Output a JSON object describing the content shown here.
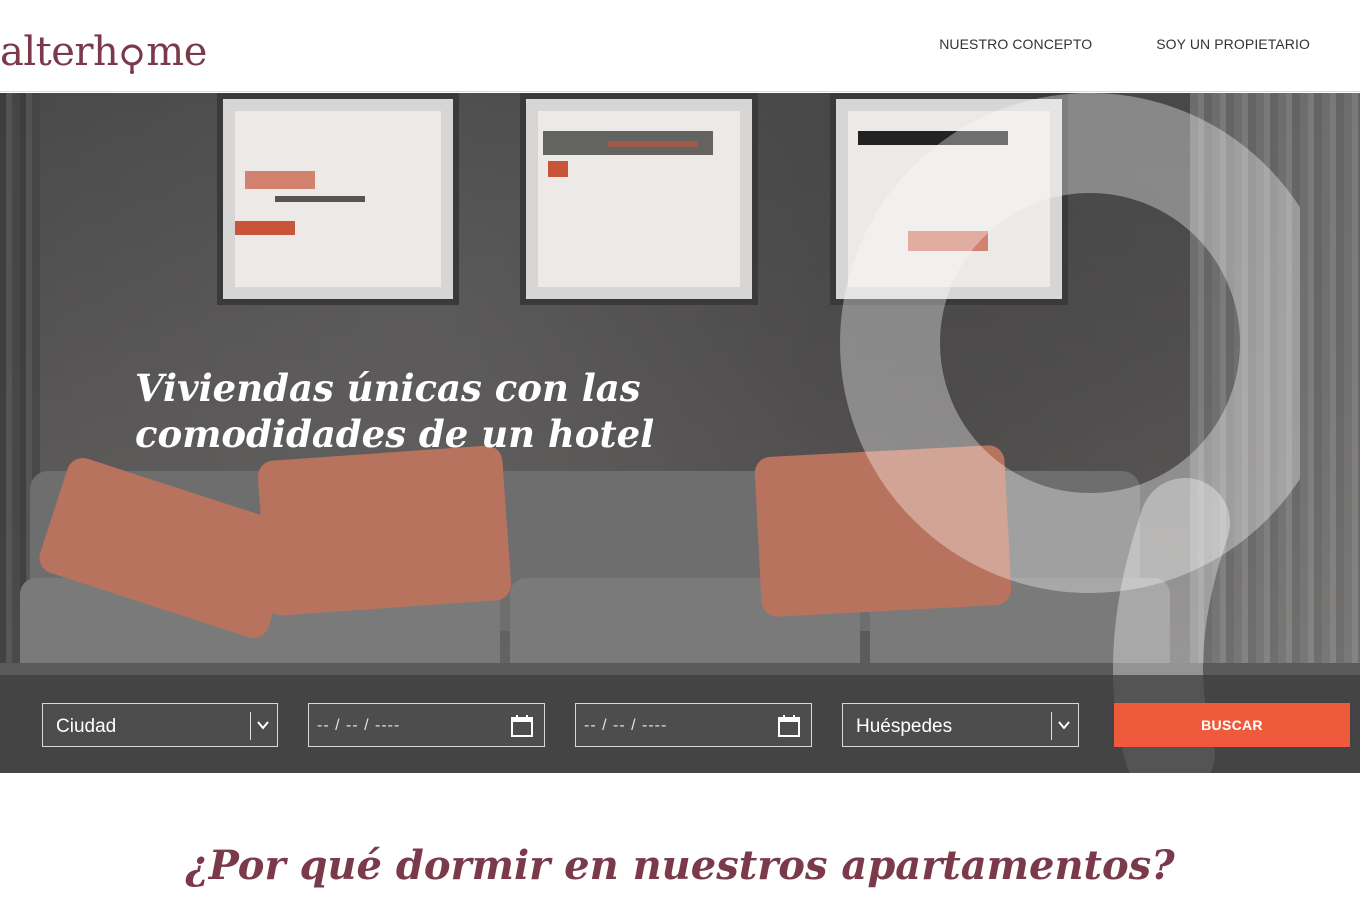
{
  "brand": {
    "logo_pre": "alterh",
    "logo_post": "me",
    "color": "#7a3a4c"
  },
  "nav": {
    "items": [
      {
        "label": "NUESTRO CONCEPTO"
      },
      {
        "label": "SOY UN PROPIETARIO"
      }
    ]
  },
  "hero": {
    "title_line1": "Viviendas únicas con las",
    "title_line2": "comodidades de un hotel"
  },
  "search": {
    "city_placeholder": "Ciudad",
    "checkin_placeholder": "-- / -- / ----",
    "checkout_placeholder": "-- / -- / ----",
    "guests_placeholder": "Huéspedes",
    "submit_label": "BUSCAR",
    "submit_color": "#f05a3c"
  },
  "section": {
    "title": "¿Por qué dormir en nuestros apartamentos?"
  },
  "icons": [
    "location-pin-icon",
    "chevron-down-icon",
    "calendar-icon"
  ]
}
